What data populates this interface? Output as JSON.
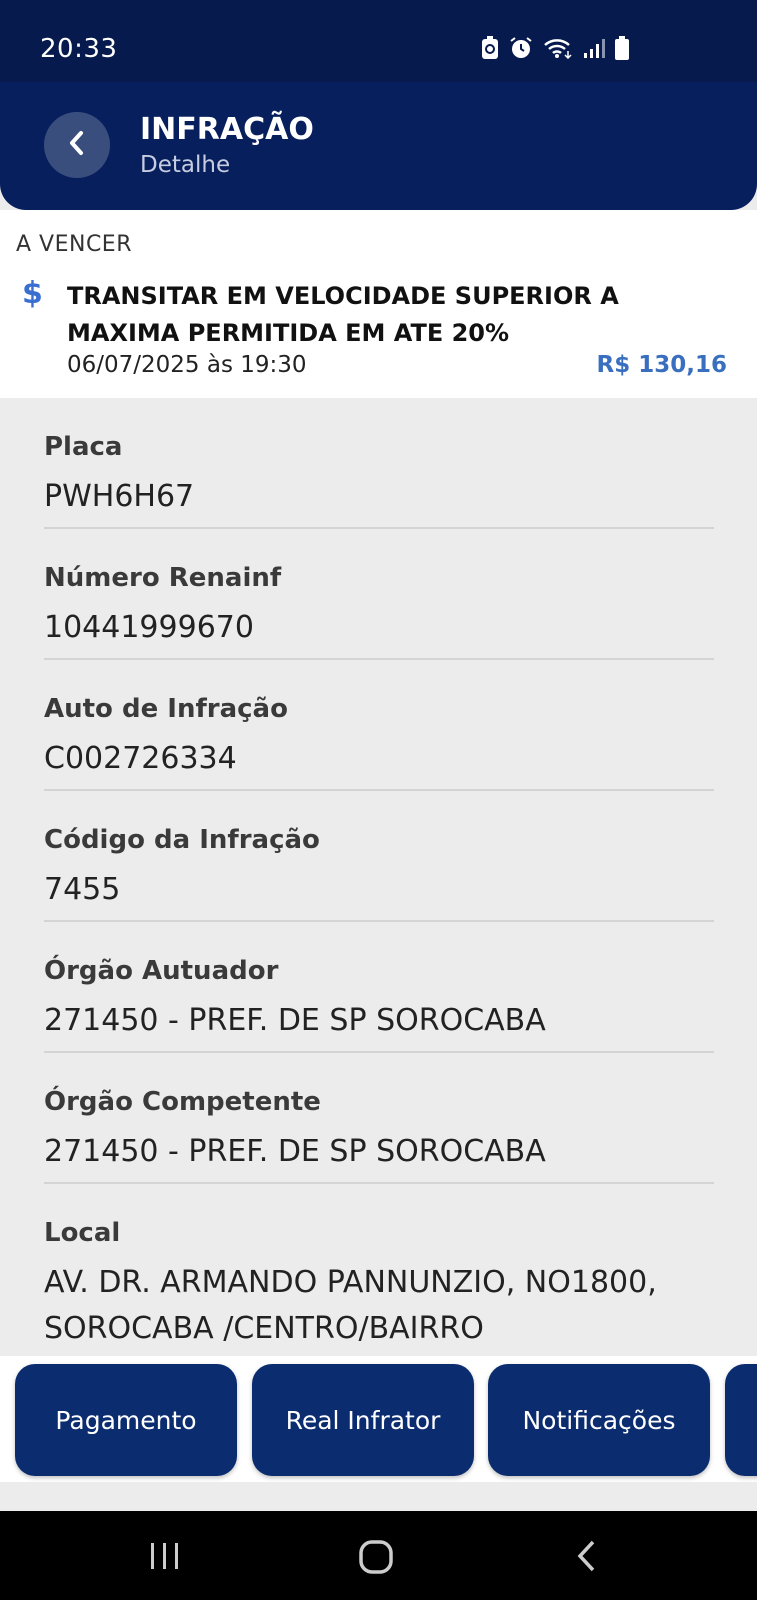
{
  "status_bar": {
    "time": "20:33",
    "icons": [
      "battery-saver-icon",
      "alarm-icon",
      "wifi-icon",
      "signal-icon",
      "battery-icon"
    ]
  },
  "header": {
    "title": "INFRAÇÃO",
    "subtitle": "Detalhe",
    "back_icon": "chevron-left-icon"
  },
  "summary": {
    "status": "A VENCER",
    "icon_symbol": "$",
    "description": "TRANSITAR EM VELOCIDADE SUPERIOR A MAXIMA PERMITIDA EM ATE 20%",
    "datetime": "06/07/2025 às 19:30",
    "amount": "R$ 130,16",
    "accent_color": "#3a6fbf"
  },
  "details": [
    {
      "label": "Placa",
      "value": "PWH6H67"
    },
    {
      "label": "Número Renainf",
      "value": "10441999670"
    },
    {
      "label": "Auto de Infração",
      "value": "C002726334"
    },
    {
      "label": "Código da Infração",
      "value": "7455"
    },
    {
      "label": "Órgão Autuador",
      "value": "271450 - PREF. DE SP SOROCABA"
    },
    {
      "label": "Órgão Competente",
      "value": "271450 - PREF. DE SP SOROCABA"
    },
    {
      "label": "Local",
      "value": "AV. DR. ARMANDO PANNUNZIO, NO1800, SOROCABA /CENTRO/BAIRRO"
    }
  ],
  "actions": [
    {
      "label": "Pagamento"
    },
    {
      "label": "Real Infrator"
    },
    {
      "label": "Notificações"
    }
  ],
  "colors": {
    "header_bg": "#081f5e",
    "button_bg": "#0c2c70"
  },
  "nav_bar": [
    "recent-apps-icon",
    "home-icon",
    "back-icon"
  ]
}
